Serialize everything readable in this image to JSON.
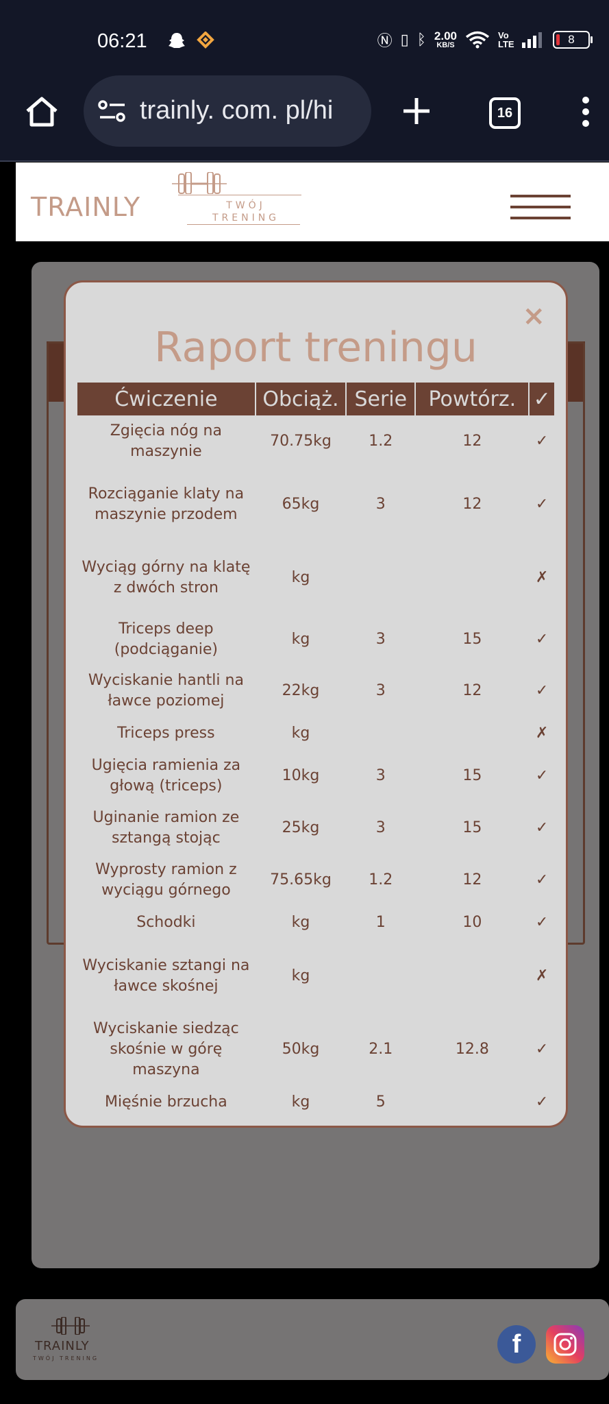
{
  "status_bar": {
    "time": "06:21",
    "net_speed": "2.00",
    "net_speed_unit": "KB/S",
    "network_type": "Vo LTE",
    "battery": "8"
  },
  "browser": {
    "url": "trainly. com. pl/hi",
    "tab_count": "16"
  },
  "header": {
    "brand": "TRAINLY",
    "tagline_1": "TWÓJ",
    "tagline_2": "TRENING"
  },
  "modal": {
    "title": "Raport treningu",
    "close_glyph": "×",
    "columns": [
      "Ćwiczenie",
      "Obciąż.",
      "Serie",
      "Powtórz.",
      "✓"
    ],
    "rows": [
      {
        "name": "Zgięcia nóg na maszynie",
        "load": "70.75kg",
        "sets": "1.2",
        "reps": "12",
        "done": "✓"
      },
      {
        "name": "Rozciąganie klaty na maszynie przodem",
        "load": "65kg",
        "sets": "3",
        "reps": "12",
        "done": "✓"
      },
      {
        "name": "Wyciąg górny na klatę z dwóch stron",
        "load": "kg",
        "sets": "",
        "reps": "",
        "done": "✗"
      },
      {
        "name": "Triceps deep (podciąganie)",
        "load": "kg",
        "sets": "3",
        "reps": "15",
        "done": "✓"
      },
      {
        "name": "Wyciskanie hantli na ławce poziomej",
        "load": "22kg",
        "sets": "3",
        "reps": "12",
        "done": "✓"
      },
      {
        "name": "Triceps press",
        "load": "kg",
        "sets": "",
        "reps": "",
        "done": "✗"
      },
      {
        "name": "Ugięcia ramienia za głową (triceps)",
        "load": "10kg",
        "sets": "3",
        "reps": "15",
        "done": "✓"
      },
      {
        "name": "Uginanie ramion ze sztangą stojąc",
        "load": "25kg",
        "sets": "3",
        "reps": "15",
        "done": "✓"
      },
      {
        "name": "Wyprosty ramion z wyciągu górnego",
        "load": "75.65kg",
        "sets": "1.2",
        "reps": "12",
        "done": "✓"
      },
      {
        "name": "Schodki",
        "load": "kg",
        "sets": "1",
        "reps": "10",
        "done": "✓"
      },
      {
        "name": "Wyciskanie sztangi na ławce skośnej",
        "load": "kg",
        "sets": "",
        "reps": "",
        "done": "✗"
      },
      {
        "name": "Wyciskanie siedząc skośnie w górę maszyna",
        "load": "50kg",
        "sets": "2.1",
        "reps": "12.8",
        "done": "✓"
      },
      {
        "name": "Mięśnie brzucha",
        "load": "kg",
        "sets": "5",
        "reps": "",
        "done": "✓"
      }
    ]
  },
  "footer": {
    "brand": "TRAINLY",
    "tagline": "TWÓJ TRENING",
    "facebook_letter": "f"
  },
  "colors": {
    "accent": "#c49b88",
    "dark_brown": "#6b4234",
    "modal_bg": "#d9d9d9",
    "chrome_bg": "#131727"
  },
  "icons": [
    "home-icon",
    "site-settings-icon",
    "plus-icon",
    "more-icon",
    "hamburger-icon",
    "dumbbell-icon",
    "facebook-icon",
    "instagram-icon"
  ]
}
